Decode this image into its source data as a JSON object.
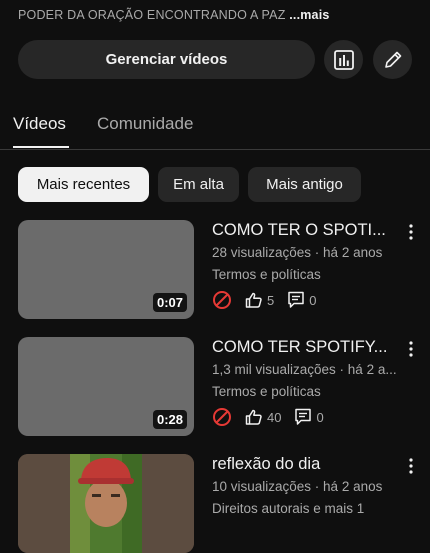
{
  "channel": {
    "description": "PODER DA ORAÇÃO ENCONTRANDO A PAZ",
    "more_label": "...mais",
    "manage_button": "Gerenciar vídeos",
    "analytics_icon": "bar-chart-icon",
    "edit_icon": "pencil-icon"
  },
  "tabs": [
    {
      "label": "Vídeos",
      "selected": true
    },
    {
      "label": "Comunidade",
      "selected": false
    }
  ],
  "filters": [
    {
      "label": "Mais recentes",
      "selected": true
    },
    {
      "label": "Em alta",
      "selected": false
    },
    {
      "label": "Mais antigo",
      "selected": false
    }
  ],
  "videos": [
    {
      "title": "COMO TER O SPOTI...",
      "meta": "28 visualizações · há 2 anos",
      "status": "Termos e políticas",
      "duration": "0:07",
      "likes": "5",
      "comments": "0"
    },
    {
      "title": "COMO TER SPOTIFY...",
      "meta": "1,3 mil visualizações · há 2 a...",
      "status": "Termos e políticas",
      "duration": "0:28",
      "likes": "40",
      "comments": "0"
    },
    {
      "title": "reflexão do dia",
      "meta": "10 visualizações · há 2 anos",
      "status": "Direitos autorais e mais 1"
    }
  ],
  "colors": {
    "background": "#0f0f0f",
    "chip_active": "#f1f1f1",
    "restricted_red": "#e53935",
    "secondary_text": "#aaaaaa"
  }
}
